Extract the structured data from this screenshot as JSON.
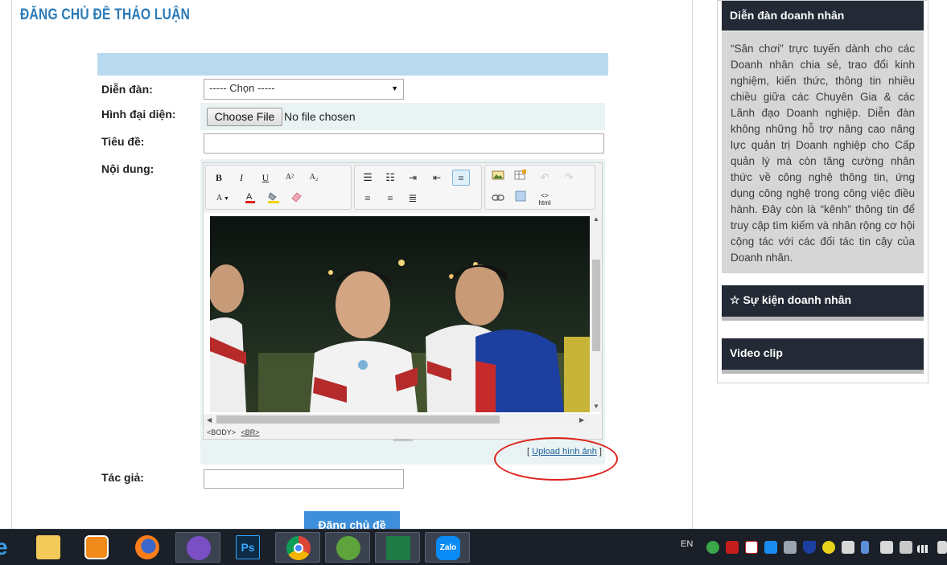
{
  "page": {
    "title": "ĐĂNG CHỦ ĐỀ THẢO LUẬN"
  },
  "form": {
    "forum_label": "Diễn đàn:",
    "forum_select_value": "----- Chọn -----",
    "avatar_label": "Hình đại diện:",
    "choose_file_label": "Choose File",
    "no_file_text": "No file chosen",
    "title_label": "Tiêu đề:",
    "title_value": "",
    "content_label": "Nội dung:",
    "author_label": "Tác giả:",
    "author_value": "",
    "submit_label": "Đăng chủ đề"
  },
  "editor": {
    "toolbar": {
      "bold": "B",
      "italic": "I",
      "underline": "U",
      "superscript": "A²",
      "subscript": "A₂",
      "font_size": "A",
      "html_label": "html"
    },
    "status_body": "<BODY>",
    "status_br": "<BR>",
    "upload_prefix": "[ ",
    "upload_link": "Upload hình ảnh",
    "upload_suffix": " ]"
  },
  "sidebar": {
    "forum_heading": "Diễn đàn doanh nhân",
    "forum_description": "“Sân chơi” trực tuyến dành cho các Doanh nhân chia sẻ, trao đổi kinh nghiệm, kiến thức, thông tin nhiều chiều giữa các Chuyên Gia & các Lãnh đạo Doanh nghiệp. Diễn đàn không những hỗ trợ nâng cao năng lực quản trị Doanh nghiệp cho Cấp quản lý mà còn tăng cường nhân thức về công nghệ thông tin, ứng dụng công nghệ trong công việc điều hành. Đây còn là “kênh” thông tin để truy cập tìm kiếm và nhân rộng cơ hội cộng tác với các đối tác tin cậy của Doanh nhân.",
    "events_heading": "Sự kiện doanh nhân",
    "video_heading": "Video clip"
  },
  "taskbar": {
    "language": "EN",
    "photoshop_label": "Ps",
    "zalo_label": "Zalo"
  },
  "colors": {
    "title_blue": "#2a7bb8",
    "header_bar": "#b9d9ef",
    "submit_blue": "#3d8edb",
    "sidebar_head": "#232a35",
    "highlight_red": "#e0231c"
  }
}
